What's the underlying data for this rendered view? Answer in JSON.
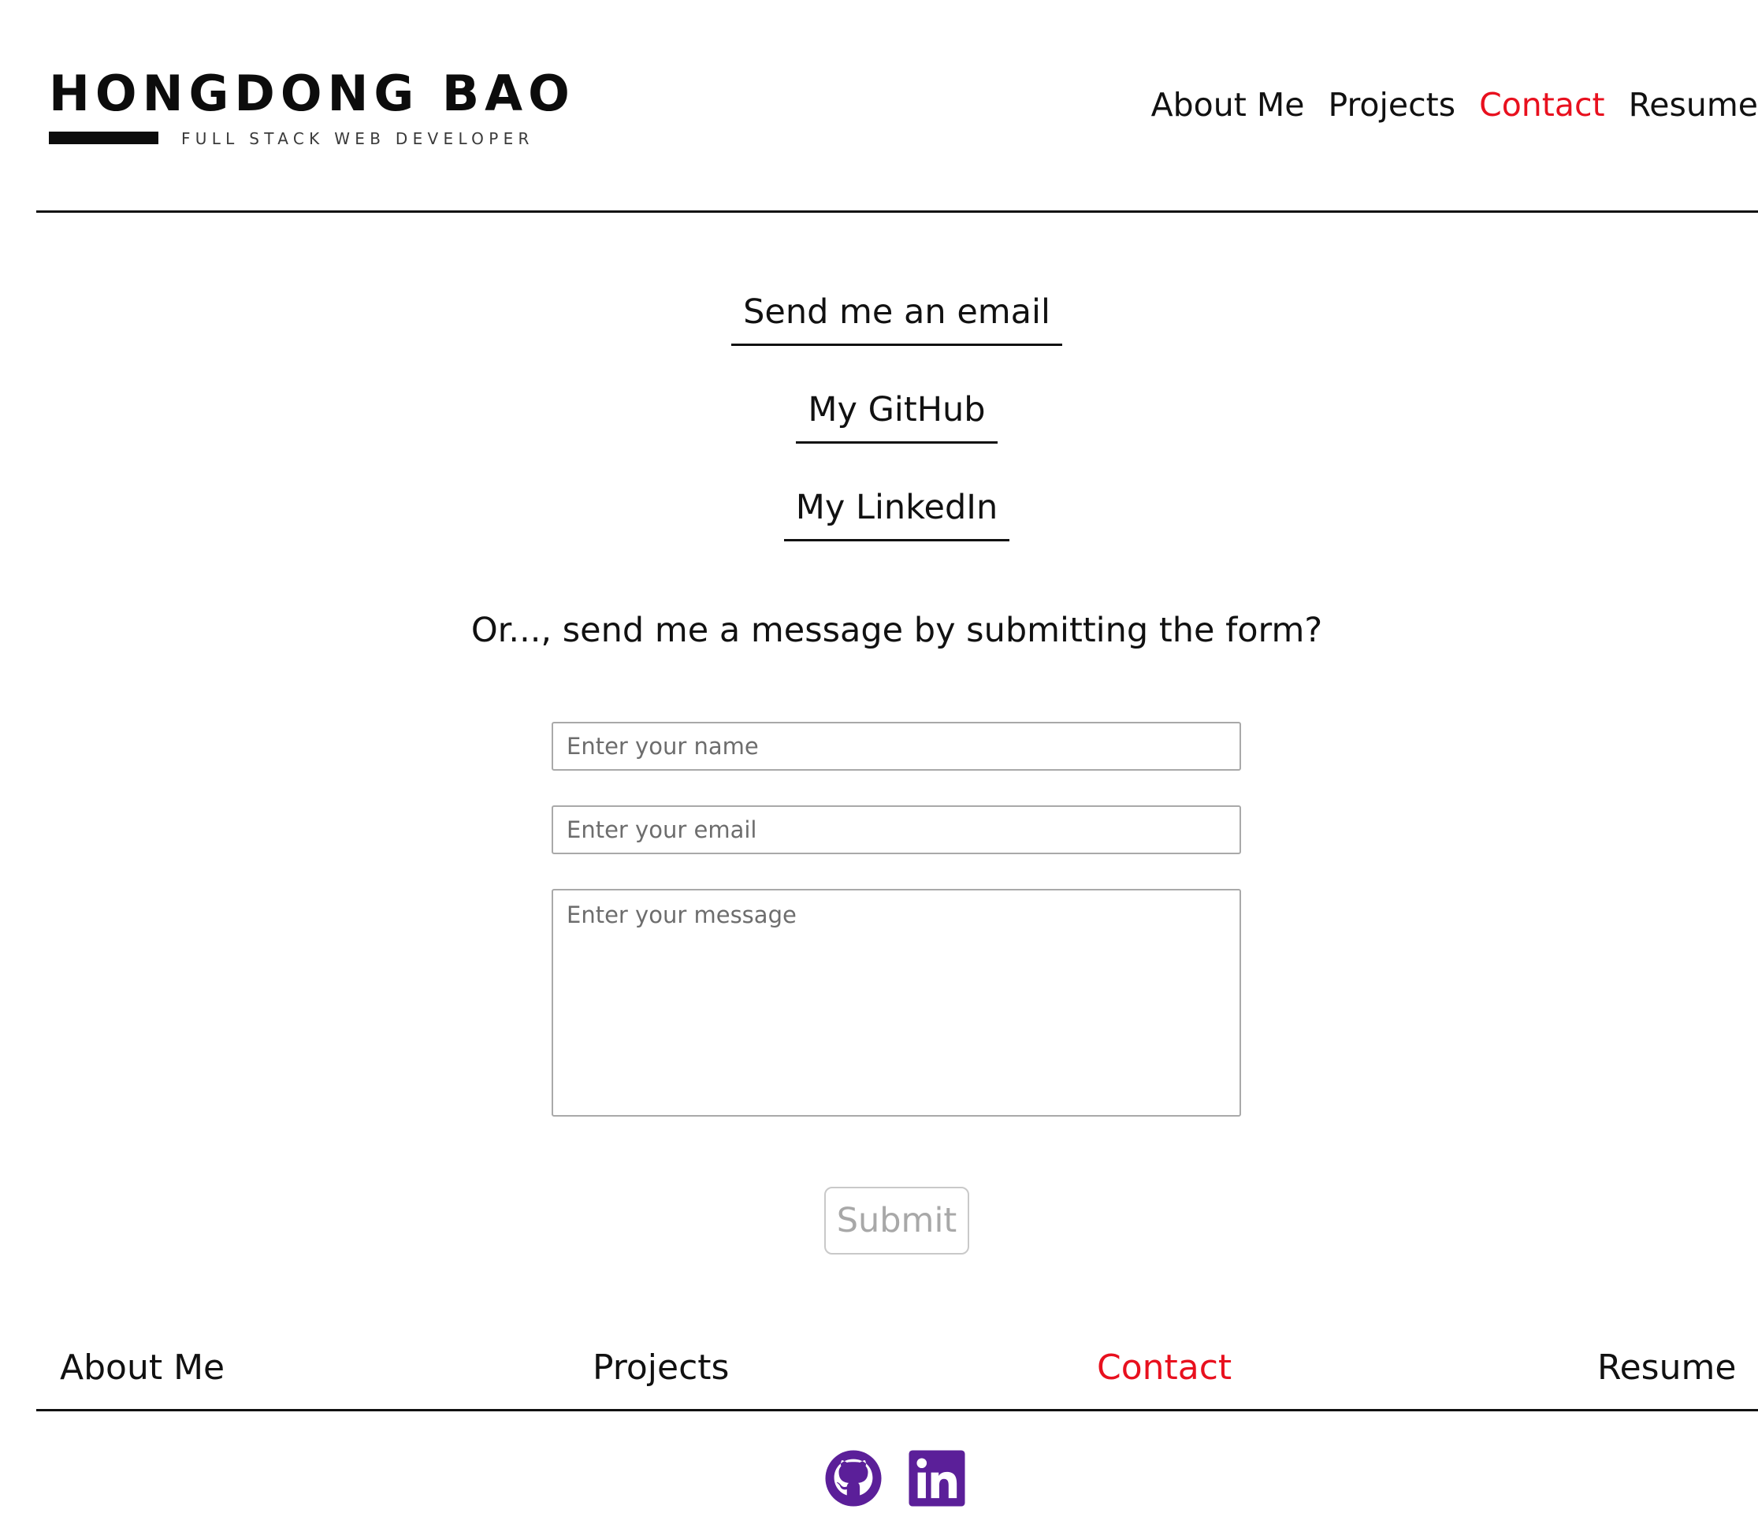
{
  "header": {
    "logo_name": "HONGDONG BAO",
    "logo_tagline": "FULL STACK WEB DEVELOPER",
    "nav": [
      {
        "label": "About Me",
        "active": false
      },
      {
        "label": "Projects",
        "active": false
      },
      {
        "label": "Contact",
        "active": true
      },
      {
        "label": "Resume",
        "active": false
      }
    ]
  },
  "contact": {
    "email_link": "Send me an email",
    "github_link": "My GitHub",
    "linkedin_link": "My LinkedIn"
  },
  "form": {
    "heading": "Or..., send me a message by submitting the form?",
    "name_placeholder": "Enter your name",
    "email_placeholder": "Enter your email",
    "message_placeholder": "Enter your message",
    "submit_label": "Submit"
  },
  "footer": {
    "nav": [
      {
        "label": "About Me",
        "active": false
      },
      {
        "label": "Projects",
        "active": false
      },
      {
        "label": "Contact",
        "active": true
      },
      {
        "label": "Resume",
        "active": false
      }
    ],
    "social_icons": [
      "github-icon",
      "linkedin-icon"
    ]
  },
  "colors": {
    "text": "#111111",
    "active_nav": "#e8101e",
    "social_icon": "#5b1f99",
    "submit_text": "#a8a8a8",
    "field_border": "#a9a9a9"
  }
}
